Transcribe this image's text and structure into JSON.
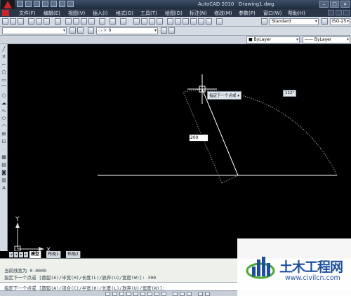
{
  "window": {
    "title": "AutoCAD 2010",
    "document": "Drawing1.dwg",
    "controls": [
      "–",
      "□",
      "×"
    ]
  },
  "menu": {
    "items": [
      "文件(F)",
      "编辑(E)",
      "视图(V)",
      "插入(I)",
      "格式(O)",
      "工具(T)",
      "绘图(D)",
      "标注(N)",
      "修改(M)",
      "参数(P)",
      "窗口(W)",
      "帮助(H)"
    ]
  },
  "toolbar": {
    "text_style": "Standard",
    "dim_style": "ISO-25",
    "layer": "0",
    "color": "ByLayer",
    "linetype": "ByLayer"
  },
  "drawing": {
    "prompt_tooltip": "指定下一个点或",
    "angle_tooltip": "112°",
    "length_input": "200",
    "ucs_y": "Y",
    "ucs_x": "X"
  },
  "tabs": {
    "model": "模型",
    "layout1": "布局1",
    "layout2": "布局2"
  },
  "command": {
    "history": [
      "当前线宽为 0.0000",
      "指定下一个点或 [圆弧(A)/半宽(H)/长度(L)/放弃(U)/宽度(W)]: 300"
    ],
    "prompt": "指定下一个点或 [圆弧(A)/闭合(C)/半宽(H)/长度(L)/放弃(U)/宽度(W)]:"
  },
  "watermark": {
    "brand": "土木工程网",
    "url": "www.civilcn.com"
  },
  "colors": {
    "titlebar": "#1f2c3e",
    "canvas": "#000000",
    "watermark_blue": "#1d4f9e",
    "watermark_green": "#4aa832"
  }
}
